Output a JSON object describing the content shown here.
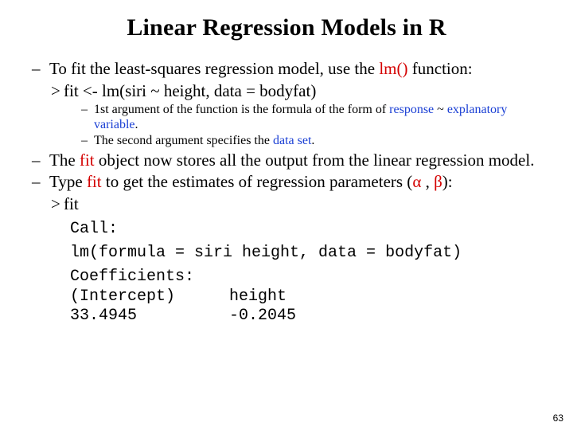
{
  "title": "Linear Regression Models in R",
  "bullet1": {
    "prefix": "To fit the least-squares regression model, use the ",
    "fn": "lm()",
    "suffix": " function:"
  },
  "code1": "fit <- lm(siri ~ height, data = bodyfat)",
  "sub1": {
    "a": "1st argument of the function is the formula of the form of ",
    "resp": "response",
    "tilde": " ~ ",
    "expl": "explanatory variable",
    "dot": "."
  },
  "sub2": {
    "a": "The second argument specifies the ",
    "ds": "data set",
    "dot": "."
  },
  "bullet2": {
    "a": "The ",
    "fit": "fit",
    "b": " object now stores all the output from the linear regression model."
  },
  "bullet3": {
    "a": "Type ",
    "fit": "fit",
    "b": " to get the estimates of regression parameters (",
    "alpha": "α",
    "comma": " , ",
    "beta": "β",
    "c": "):"
  },
  "code2": "fit",
  "out": {
    "l1": "Call:",
    "l2": "lm(formula = siri height, data = bodyfat)",
    "l3": "Coefficients:",
    "c1a": "(Intercept)",
    "c1b": "height",
    "c2a": "    33.4945",
    "c2b": "-0.2045"
  },
  "page": "63"
}
